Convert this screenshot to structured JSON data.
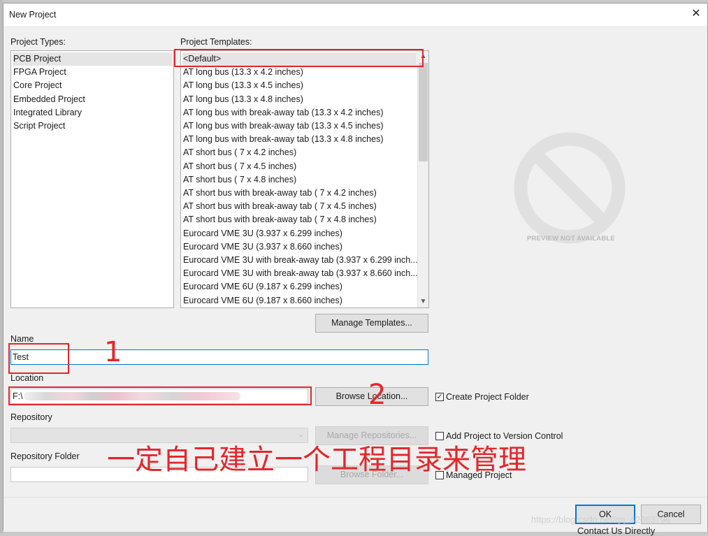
{
  "window": {
    "title": "New Project"
  },
  "project_types": {
    "label": "Project Types:",
    "items": [
      "PCB Project",
      "FPGA Project",
      "Core Project",
      "Embedded Project",
      "Integrated Library",
      "Script Project"
    ],
    "selected": 0
  },
  "project_templates": {
    "label": "Project Templates:",
    "items": [
      "<Default>",
      "AT long bus (13.3 x 4.2 inches)",
      "AT long bus (13.3 x 4.5 inches)",
      "AT long bus (13.3 x 4.8 inches)",
      "AT long bus with break-away tab (13.3 x 4.2 inches)",
      "AT long bus with break-away tab (13.3 x 4.5 inches)",
      "AT long bus with break-away tab (13.3 x 4.8 inches)",
      "AT short bus ( 7 x 4.2 inches)",
      "AT short bus ( 7 x 4.5 inches)",
      "AT short bus ( 7 x 4.8 inches)",
      "AT short bus with break-away tab ( 7 x 4.2 inches)",
      "AT short bus with break-away tab ( 7 x 4.5 inches)",
      "AT short bus with break-away tab ( 7 x 4.8 inches)",
      "Eurocard VME 3U (3.937 x 6.299 inches)",
      "Eurocard VME 3U (3.937 x 8.660 inches)",
      "Eurocard VME 3U with break-away tab (3.937 x 6.299 inch...",
      "Eurocard VME 3U with break-away tab (3.937 x 8.660 inch...",
      "Eurocard VME 6U (9.187 x 6.299 inches)",
      "Eurocard VME 6U (9.187 x 8.660 inches)"
    ],
    "selected": 0,
    "manage_button": "Manage Templates..."
  },
  "preview": {
    "text": "PREVIEW NOT AVAILABLE"
  },
  "name": {
    "label": "Name",
    "value": "Test"
  },
  "location": {
    "label": "Location",
    "value": "F:\\",
    "browse_button": "Browse Location...",
    "create_folder_label": "Create Project Folder",
    "create_folder_checked": true
  },
  "repository": {
    "label": "Repository",
    "manage_button": "Manage Repositories...",
    "add_vc_label": "Add Project to Version Control",
    "add_vc_checked": false
  },
  "repository_folder": {
    "label": "Repository Folder",
    "browse_button": "Browse Folder...",
    "managed_label": "Managed Project",
    "managed_checked": false
  },
  "footer": {
    "ok": "OK",
    "cancel": "Cancel"
  },
  "annotations": {
    "marker_1": "1",
    "marker_2": "2",
    "note": "一定自己建立一个工程目录来管理"
  },
  "colors": {
    "annotation_red": "#e3262b",
    "focus_blue": "#0078d7"
  },
  "watermark": "https://blog.csdn.net/qq_42263796",
  "background_text": "Contact Us Directly"
}
